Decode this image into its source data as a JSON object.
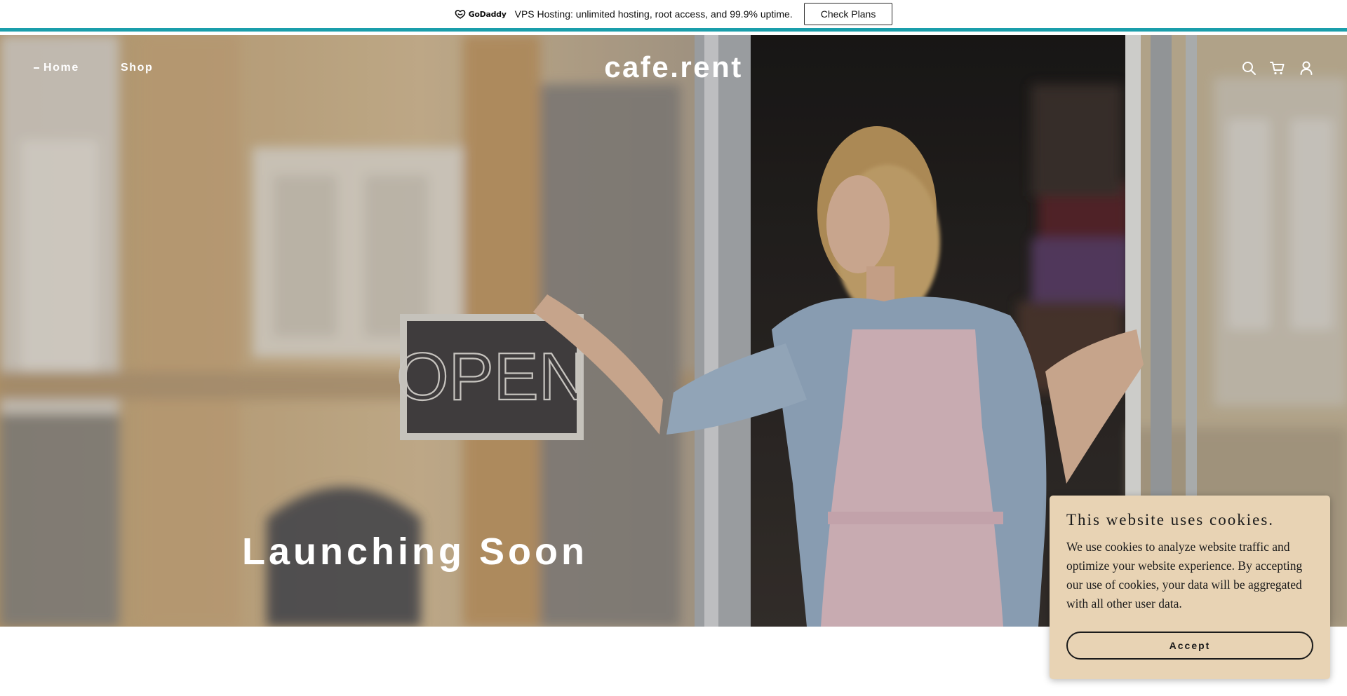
{
  "promo": {
    "logo_text": "GoDaddy",
    "message": "VPS Hosting: unlimited hosting, root access, and 99.9% uptime.",
    "button_label": "Check Plans"
  },
  "header": {
    "nav": [
      {
        "label": "Home"
      },
      {
        "label": "Shop"
      }
    ],
    "logo": "cafe.rent",
    "icons": [
      "search-icon",
      "cart-icon",
      "account-icon"
    ]
  },
  "hero": {
    "title": "Launching Soon",
    "sign_text": "OPEN"
  },
  "cookie": {
    "title": "This website uses cookies.",
    "body": "We use cookies to analyze website traffic and optimize your website experience. By accepting our use of cookies, your data will be aggregated with all other user data.",
    "accept_label": "Accept"
  },
  "colors": {
    "accent_bar": "#1a9eab",
    "cookie_background": "#e8d3b4"
  }
}
